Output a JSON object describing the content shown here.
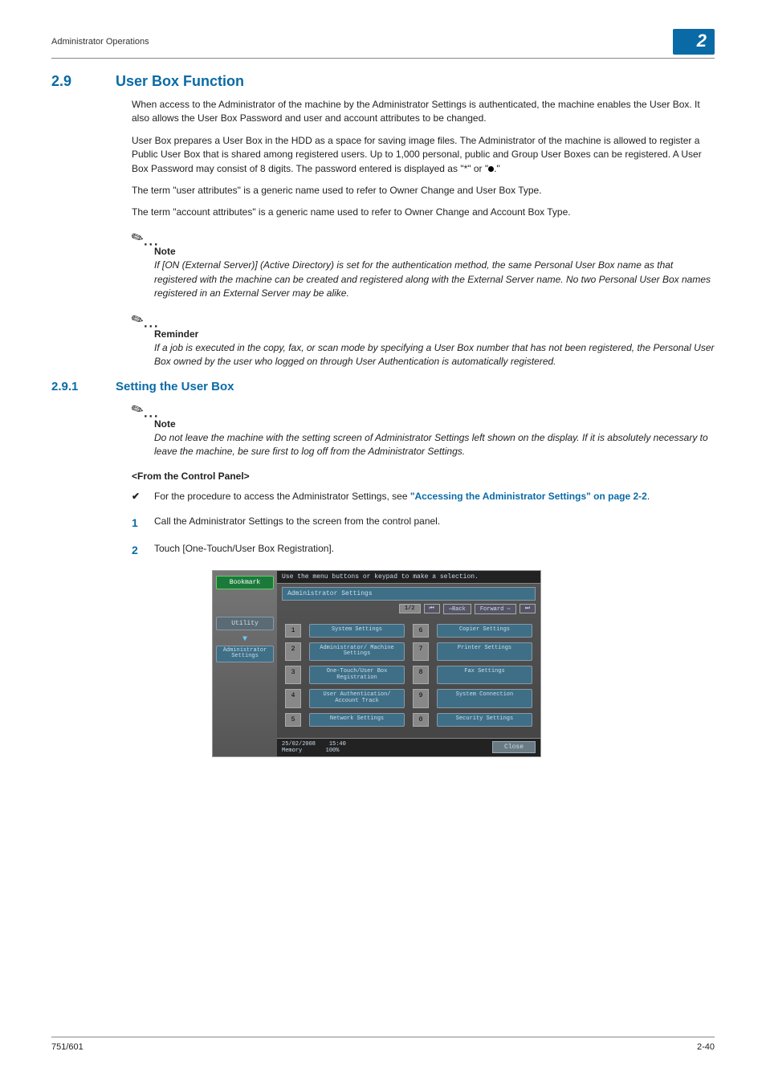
{
  "header": {
    "left": "Administrator Operations",
    "right": "2"
  },
  "section": {
    "num": "2.9",
    "title": "User Box Function"
  },
  "paragraphs": {
    "p1": "When access to the Administrator of the machine by the Administrator Settings is authenticated, the machine enables the User Box. It also allows the User Box Password and user and account attributes to be changed.",
    "p2a": "User Box prepares a User Box in the HDD as a space for saving image files. The Administrator of the machine is allowed to register a Public User Box that is shared among registered users. Up to 1,000 personal, public and Group User Boxes can be registered. A User Box Password may consist of 8 digits. The password entered is displayed as \"*\" or \"",
    "p2b": ".\"",
    "p3": "The term \"user attributes\" is a generic name used to refer to Owner Change and User Box Type.",
    "p4": "The term \"account attributes\" is a generic name used to refer to Owner Change and Account Box Type."
  },
  "note1": {
    "label": "Note",
    "text": "If [ON (External Server)] (Active Directory) is set for the authentication method, the same Personal User Box name as that registered with the machine can be created and registered along with the External Server name. No two Personal User Box names registered in an External Server may be alike."
  },
  "reminder": {
    "label": "Reminder",
    "text": "If a job is executed in the copy, fax, or scan mode by specifying a User Box number that has not been registered, the Personal User Box owned by the user who logged on through User Authentication is automatically registered."
  },
  "subsection": {
    "num": "2.9.1",
    "title": "Setting the User Box"
  },
  "note2": {
    "label": "Note",
    "text": "Do not leave the machine with the setting screen of Administrator Settings left shown on the display. If it is absolutely necessary to leave the machine, be sure first to log off from the Administrator Settings."
  },
  "control_panel_head": "<From the Control Panel>",
  "bullet": {
    "pre": "For the procedure to access the Administrator Settings, see ",
    "link": "\"Accessing the Administrator Settings\" on page 2-2",
    "post": "."
  },
  "step1": "Call the Administrator Settings to the screen from the control panel.",
  "step2": "Touch [One-Touch/User Box Registration].",
  "screenshot": {
    "instr": "Use the menu buttons or keypad to make a selection.",
    "bookmark": "Bookmark",
    "utility": "Utility",
    "admin_settings": "Administrator Settings",
    "title": "Administrator Settings",
    "page": "1/2",
    "back": "⇦Back",
    "fwd": "Forward ⇨",
    "menu": [
      {
        "n": "1",
        "t": "System Settings"
      },
      {
        "n": "6",
        "t": "Copier Settings"
      },
      {
        "n": "2",
        "t": "Administrator/\nMachine Settings"
      },
      {
        "n": "7",
        "t": "Printer Settings"
      },
      {
        "n": "3",
        "t": "One-Touch/User Box\nRegistration"
      },
      {
        "n": "8",
        "t": "Fax Settings"
      },
      {
        "n": "4",
        "t": "User Authentication/\nAccount Track"
      },
      {
        "n": "9",
        "t": "System Connection"
      },
      {
        "n": "5",
        "t": "Network Settings"
      },
      {
        "n": "0",
        "t": "Security Settings"
      }
    ],
    "date": "25/02/2008",
    "time": "15:40",
    "mem": "Memory",
    "memval": "100%",
    "close": "Close"
  },
  "footer": {
    "left": "751/601",
    "right": "2-40"
  }
}
